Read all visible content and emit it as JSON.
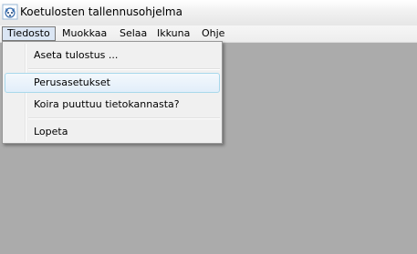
{
  "window": {
    "title": "Koetulosten tallennusohjelma",
    "icon": "dog-app-icon"
  },
  "menubar": {
    "items": [
      {
        "label": "Tiedosto",
        "open": true
      },
      {
        "label": "Muokkaa"
      },
      {
        "label": "Selaa"
      },
      {
        "label": "Ikkuna"
      },
      {
        "label": "Ohje"
      }
    ]
  },
  "file_menu": {
    "items": [
      {
        "label": "Aseta tulostus ..."
      },
      {
        "label": "Perusasetukset",
        "highlighted": true
      },
      {
        "label": "Koira puuttuu tietokannasta?"
      },
      {
        "label": "Lopeta"
      }
    ]
  },
  "colors": {
    "workspace": "#ababab",
    "menu_background": "#f0f0f0",
    "highlight_border": "#a8d8eb"
  }
}
